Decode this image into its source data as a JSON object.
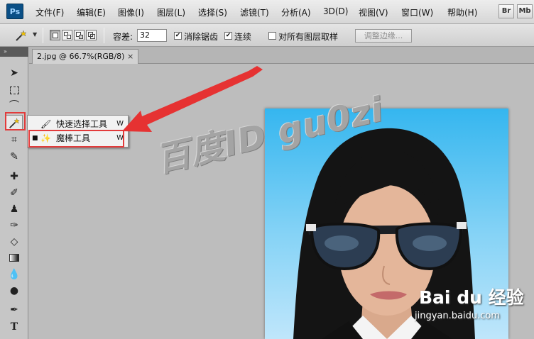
{
  "app": {
    "logo_text": "Ps"
  },
  "menu": {
    "items": [
      "文件(F)",
      "编辑(E)",
      "图像(I)",
      "图层(L)",
      "选择(S)",
      "滤镜(T)",
      "分析(A)",
      "3D(D)",
      "视图(V)",
      "窗口(W)",
      "帮助(H)"
    ],
    "bridge_label": "Br",
    "minibridge_label": "Mb"
  },
  "options": {
    "tolerance_label": "容差:",
    "tolerance_value": "32",
    "antialias_label": "消除锯齿",
    "antialias_checked": true,
    "contiguous_label": "连续",
    "contiguous_checked": true,
    "sample_all_label": "对所有图层取样",
    "sample_all_checked": false,
    "refine_edge_label": "调整边缘..."
  },
  "document": {
    "tab_title": "2.jpg @ 66.7%(RGB/8)",
    "close_glyph": "×"
  },
  "tool_panel": {
    "header_glyph": "»",
    "active_tool": "magic-wand"
  },
  "flyout": {
    "items": [
      {
        "label": "快速选择工具",
        "shortcut": "W",
        "selected": false
      },
      {
        "label": "魔棒工具",
        "shortcut": "W",
        "selected": true
      }
    ],
    "bullet": "■"
  },
  "watermark": {
    "text": "百度ID  gu0zi"
  },
  "baidu": {
    "logo_text": "Bai du 经验",
    "url": "jingyan.baidu.com"
  },
  "colors": {
    "highlight": "#e23b3b",
    "photo_bg": "#4fc1f3",
    "ps_blue": "#0a4f86"
  }
}
